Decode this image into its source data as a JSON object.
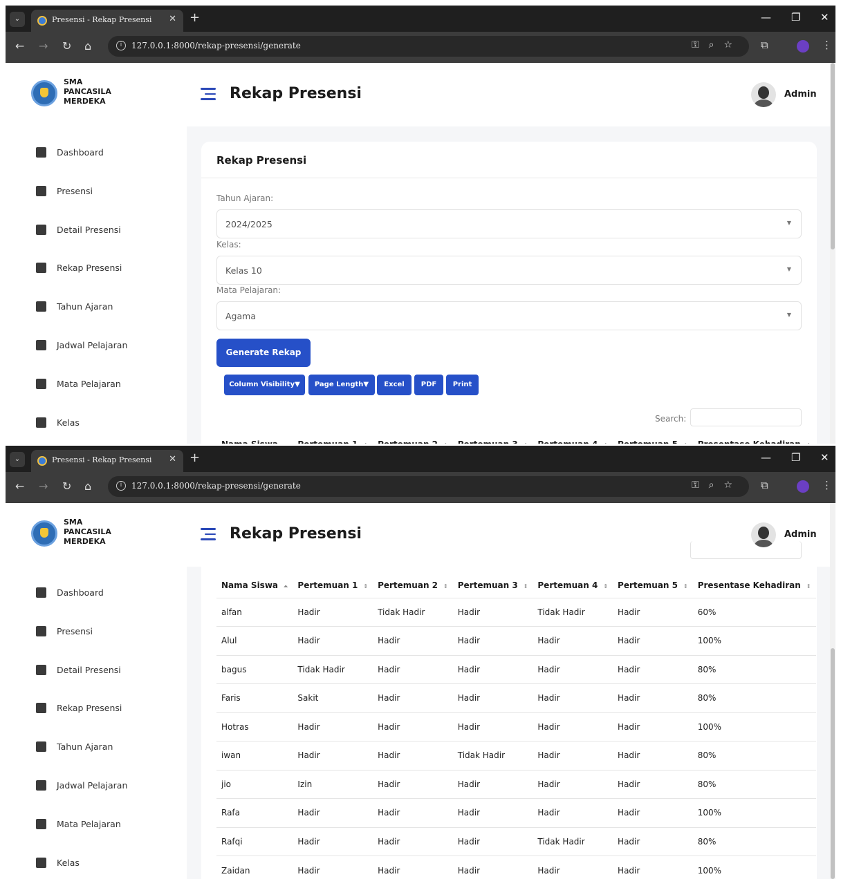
{
  "browser": {
    "tab_title": "Presensi - Rekap Presensi",
    "url": "127.0.0.1:8000/rekap-presensi/generate"
  },
  "app": {
    "school_lines": [
      "SMA",
      "PANCASILA",
      "MERDEKA"
    ],
    "page_title": "Rekap Presensi",
    "user_name": "Admin"
  },
  "sidebar": {
    "items": [
      {
        "label": "Dashboard",
        "icon": "dashboard-icon"
      },
      {
        "label": "Presensi",
        "icon": "calendar-check-icon"
      },
      {
        "label": "Detail Presensi",
        "icon": "calendar-check-icon"
      },
      {
        "label": "Rekap Presensi",
        "icon": "database-icon"
      },
      {
        "label": "Tahun Ajaran",
        "icon": "calendar-icon"
      },
      {
        "label": "Jadwal Pelajaran",
        "icon": "calendar-grid-icon"
      },
      {
        "label": "Mata Pelajaran",
        "icon": "book-icon"
      },
      {
        "label": "Kelas",
        "icon": "building-icon"
      }
    ]
  },
  "form": {
    "card_title": "Rekap Presensi",
    "tahun_label": "Tahun Ajaran:",
    "tahun_value": "2024/2025",
    "kelas_label": "Kelas:",
    "kelas_value": "Kelas 10",
    "mapel_label": "Mata Pelajaran:",
    "mapel_value": "Agama",
    "generate_label": "Generate Rekap"
  },
  "datatable": {
    "buttons": [
      "Column Visibility▼",
      "Page Length▼",
      "Excel",
      "PDF",
      "Print"
    ],
    "search_label": "Search:",
    "columns": [
      "Nama Siswa",
      "Pertemuan 1",
      "Pertemuan 2",
      "Pertemuan 3",
      "Pertemuan 4",
      "Pertemuan 5",
      "Presentase Kehadiran"
    ],
    "rows": [
      [
        "alfan",
        "Hadir",
        "Tidak Hadir",
        "Hadir",
        "Tidak Hadir",
        "Hadir",
        "60%"
      ],
      [
        "Alul",
        "Hadir",
        "Hadir",
        "Hadir",
        "Hadir",
        "Hadir",
        "100%"
      ],
      [
        "bagus",
        "Tidak Hadir",
        "Hadir",
        "Hadir",
        "Hadir",
        "Hadir",
        "80%"
      ],
      [
        "Faris",
        "Sakit",
        "Hadir",
        "Hadir",
        "Hadir",
        "Hadir",
        "80%"
      ],
      [
        "Hotras",
        "Hadir",
        "Hadir",
        "Hadir",
        "Hadir",
        "Hadir",
        "100%"
      ],
      [
        "iwan",
        "Hadir",
        "Hadir",
        "Tidak Hadir",
        "Hadir",
        "Hadir",
        "80%"
      ],
      [
        "jio",
        "Izin",
        "Hadir",
        "Hadir",
        "Hadir",
        "Hadir",
        "80%"
      ],
      [
        "Rafa",
        "Hadir",
        "Hadir",
        "Hadir",
        "Hadir",
        "Hadir",
        "100%"
      ],
      [
        "Rafqi",
        "Hadir",
        "Hadir",
        "Hadir",
        "Tidak Hadir",
        "Hadir",
        "80%"
      ],
      [
        "Zaidan",
        "Hadir",
        "Hadir",
        "Hadir",
        "Hadir",
        "Hadir",
        "100%"
      ]
    ]
  },
  "colors": {
    "primary": "#2650c8",
    "chrome_dark": "#1f1f1f",
    "chrome_mid": "#3c3c3c"
  }
}
